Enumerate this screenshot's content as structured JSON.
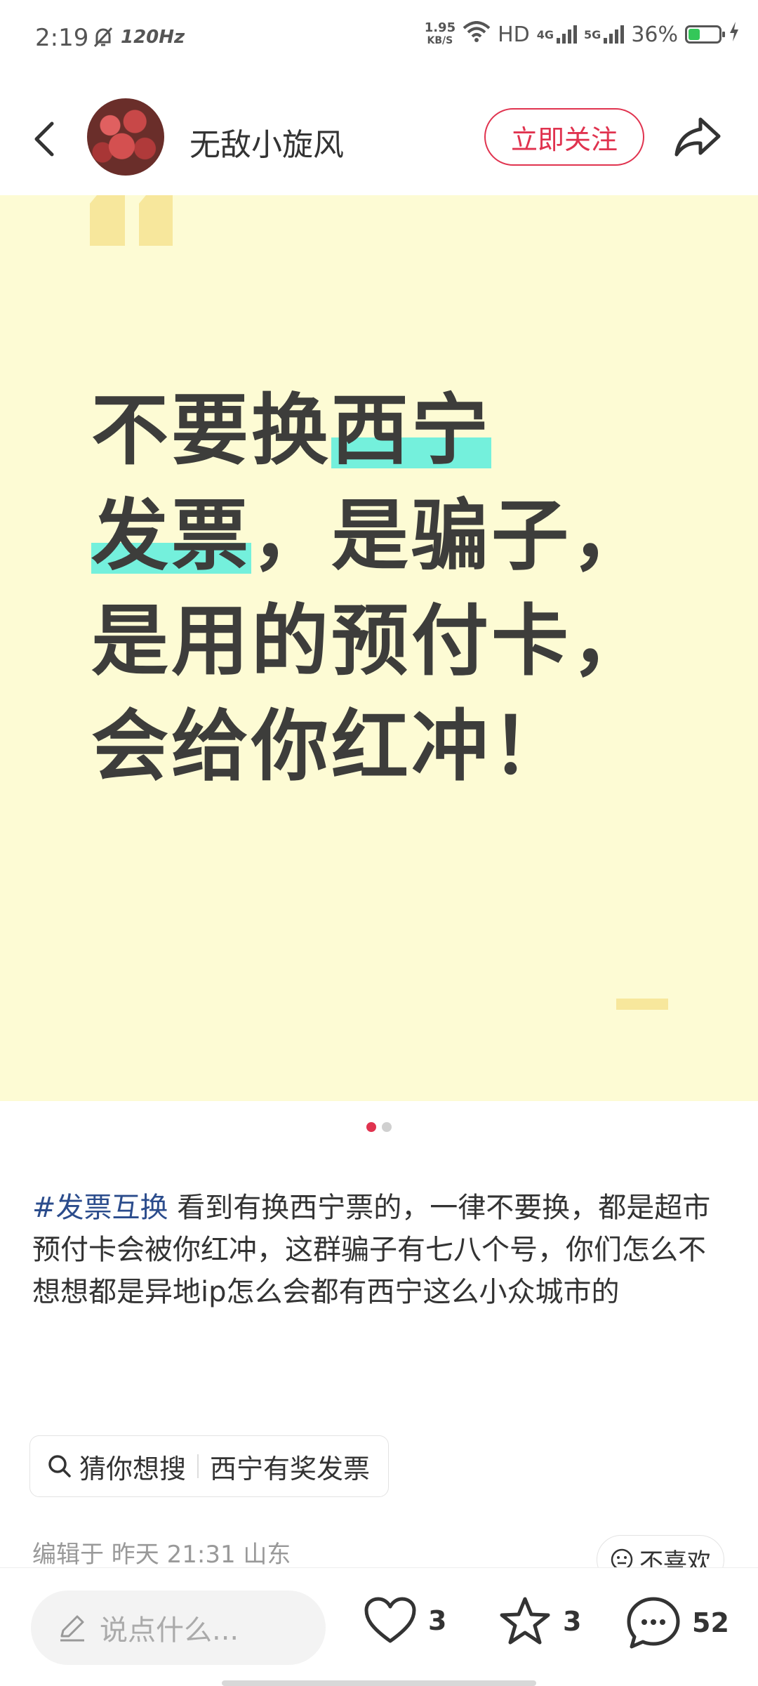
{
  "status_bar": {
    "time": "2:19",
    "refresh_rate": "120Hz",
    "net_speed": "1.95",
    "net_speed_unit": "KB/S",
    "hd_label": "HD",
    "net1": "4G",
    "net2": "5G",
    "battery": "36%",
    "battery_level": 0.36
  },
  "header": {
    "username": "无敌小旋风",
    "follow_label": "立即关注"
  },
  "banner": {
    "line1_plain": "不要换",
    "line1_hl": "西宁",
    "line2_hl": "发票",
    "line2_plain": "，是骗子，",
    "line3": "是用的预付卡，",
    "line4": "会给你红冲！"
  },
  "pager": {
    "count": 2,
    "active": 0
  },
  "post": {
    "tag": "#发票互换",
    "body": "看到有换西宁票的，一律不要换，都是超市预付卡会被你红冲，这群骗子有七八个号，你们怎么不想想都是异地ip怎么会都有西宁这么小众城市的"
  },
  "search_chip": {
    "prefix": "猜你想搜",
    "query": "西宁有奖发票"
  },
  "meta": {
    "edited": "编辑于 昨天 21:31 山东",
    "dislike": "不喜欢"
  },
  "bottom_bar": {
    "comment_placeholder": "说点什么...",
    "likes": "3",
    "favorites": "3",
    "comments": "52"
  },
  "colors": {
    "accent": "#e0334f",
    "banner_bg": "#fdfbd4",
    "highlight": "#74f0dc",
    "tag": "#2b4c8c"
  }
}
